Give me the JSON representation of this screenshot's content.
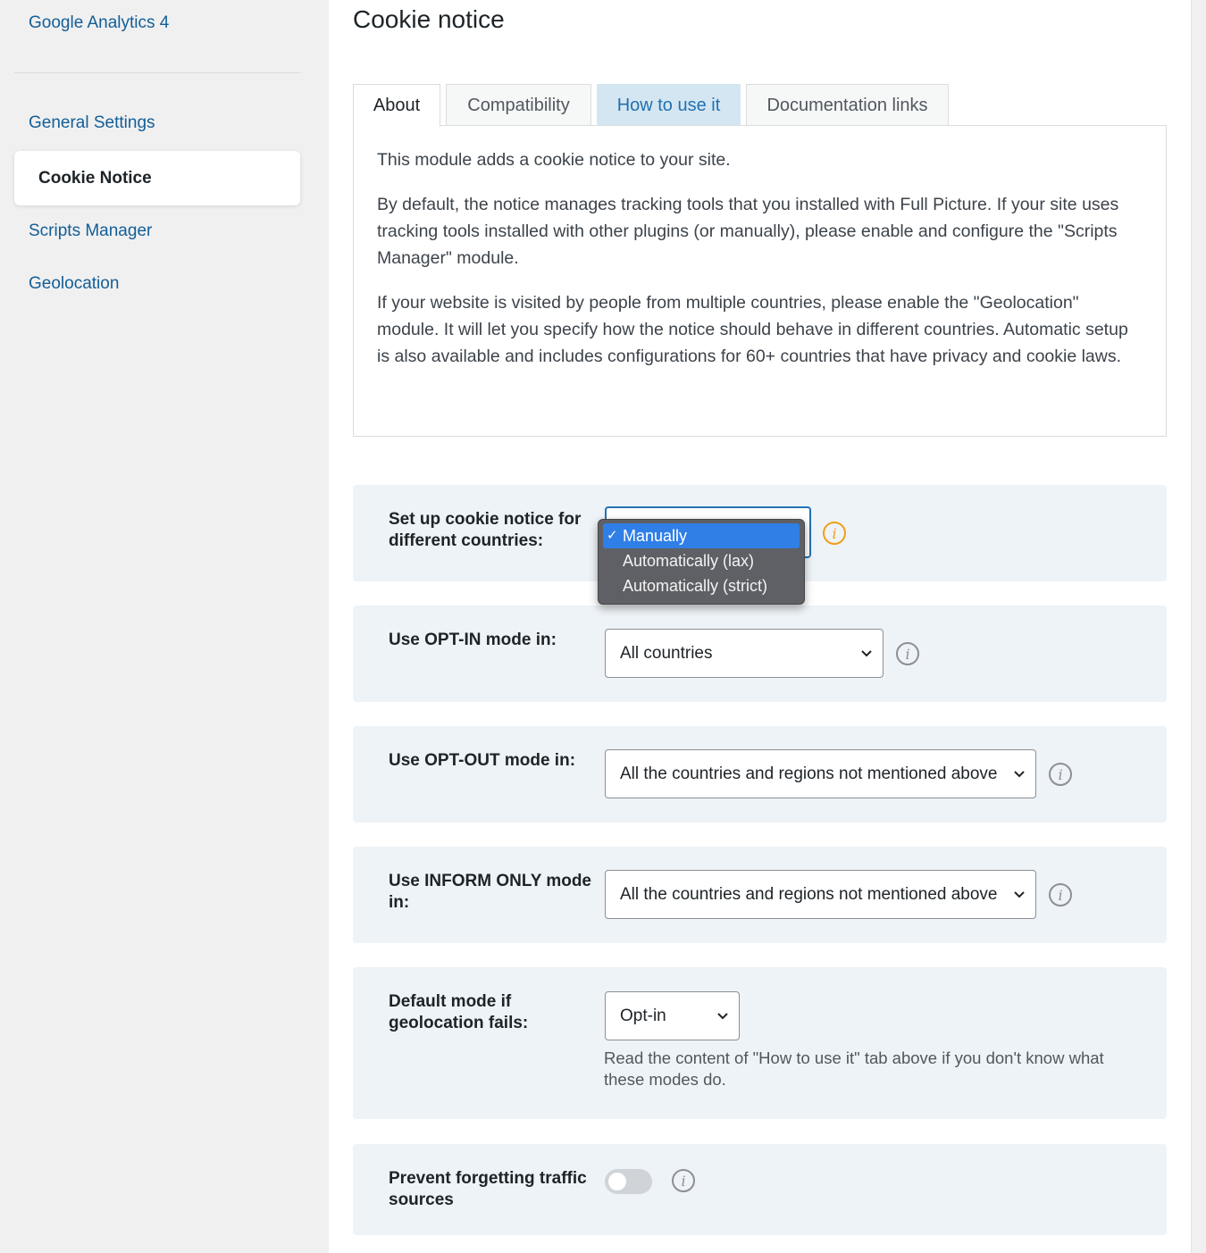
{
  "sidebar": {
    "items": [
      {
        "label": "Google Analytics 4"
      },
      {
        "label": "General Settings"
      },
      {
        "label": "Cookie Notice"
      },
      {
        "label": "Scripts Manager"
      },
      {
        "label": "Geolocation"
      }
    ]
  },
  "main": {
    "title": "Cookie notice",
    "tabs": [
      {
        "label": "About"
      },
      {
        "label": "Compatibility"
      },
      {
        "label": "How to use it"
      },
      {
        "label": "Documentation links"
      }
    ],
    "about": {
      "p1": "This module adds a cookie notice to your site.",
      "p2": "By default, the notice manages tracking tools that you installed with Full Picture. If your site uses tracking tools installed with other plugins (or manually), please enable and configure the \"Scripts Manager\" module.",
      "p3": "If your website is visited by people from multiple countries, please enable the \"Geolocation\" module. It will let you specify how the notice should behave in different countries. Automatic setup is also available and includes configurations for 60+ countries that have privacy and cookie laws."
    }
  },
  "settings": {
    "setup": {
      "label": "Set up cookie notice for different countries:",
      "options": [
        "Manually",
        "Automatically (lax)",
        "Automatically (strict)"
      ],
      "selected": "Manually",
      "check": "✓"
    },
    "opt_in": {
      "label": "Use OPT-IN mode in:",
      "value": "All countries"
    },
    "opt_out": {
      "label": "Use OPT-OUT mode in:",
      "value": "All the countries and regions not mentioned above"
    },
    "inform_only": {
      "label": "Use INFORM ONLY mode in:",
      "value": "All the countries and regions not mentioned above"
    },
    "default_mode": {
      "label": "Default mode if geolocation fails:",
      "value": "Opt-in",
      "help": "Read the content of \"How to use it\" tab above if you don't know what these modes do."
    },
    "prevent_forgetting": {
      "label": "Prevent forgetting traffic sources",
      "enabled": false
    }
  },
  "colors": {
    "accent": "#2271b1",
    "warning_icon": "#f0a018",
    "row_bg": "#eef3f7",
    "tab_highlight": "#d4e6f1"
  }
}
